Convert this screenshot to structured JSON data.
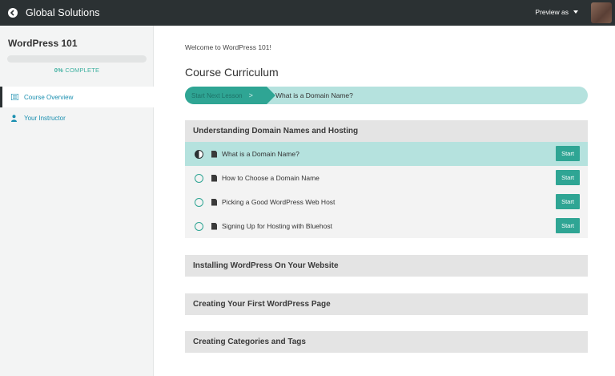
{
  "topbar": {
    "brand": "Global Solutions",
    "preview_label": "Preview as"
  },
  "sidebar": {
    "course_title": "WordPress 101",
    "progress": {
      "percent": 0,
      "percent_label": "0%",
      "complete_label": "COMPLETE"
    },
    "nav": [
      {
        "label": "Course Overview",
        "icon": "list-icon",
        "active": true
      },
      {
        "label": "Your Instructor",
        "icon": "user-icon",
        "active": false
      }
    ]
  },
  "main": {
    "welcome": "Welcome to WordPress 101!",
    "curriculum_title": "Course Curriculum",
    "next_lesson": {
      "button_label": "Start Next Lesson",
      "chevron": ">",
      "lesson_title": "What is a Domain Name?"
    },
    "sections": [
      {
        "title": "Understanding Domain Names and Hosting",
        "lessons": [
          {
            "title": "What is a Domain Name?",
            "status": "in-progress",
            "action": "Start"
          },
          {
            "title": "How to Choose a Domain Name",
            "status": "not-started",
            "action": "Start"
          },
          {
            "title": "Picking a Good WordPress Web Host",
            "status": "not-started",
            "action": "Start"
          },
          {
            "title": "Signing Up for Hosting with Bluehost",
            "status": "not-started",
            "action": "Start"
          }
        ]
      },
      {
        "title": "Installing WordPress On Your Website",
        "lessons": []
      },
      {
        "title": "Creating Your First WordPress Page",
        "lessons": []
      },
      {
        "title": "Creating Categories and Tags",
        "lessons": []
      }
    ]
  },
  "colors": {
    "accent": "#2fa594",
    "accent_light": "#b5e2de",
    "topbar": "#2b3133",
    "link": "#1a8fb0"
  }
}
